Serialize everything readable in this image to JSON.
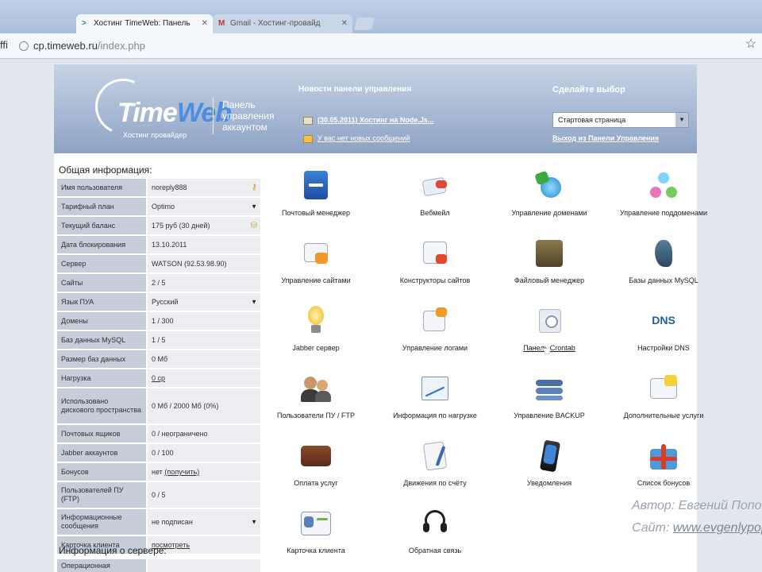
{
  "browser": {
    "tabs": [
      {
        "title": "Хостинг TimeWeb: Панель",
        "active": true,
        "icon": "chevron-logo-icon"
      },
      {
        "title": "Gmail - Хостинг-провайд",
        "active": false,
        "icon": "gmail-icon"
      }
    ],
    "url_host": "cp.timeweb.ru",
    "url_path": "/index.php",
    "menu_glyph": "ffi"
  },
  "header": {
    "logo_time": "Time",
    "logo_web": "Web",
    "logo_sub": "Хостинг провайдер",
    "panel_text": "Панель управления аккаунтом",
    "news_title": "Новости панели управления",
    "news_items": [
      {
        "text": "(30.05.2011) Хостинг на Node.Js..."
      },
      {
        "text": "У вас нет новых сообщений"
      }
    ],
    "choose_title": "Сделайте выбор",
    "select_value": "Стартовая страница",
    "logout": "Выход из Панели Управления"
  },
  "info": {
    "title": "Общая информация:",
    "rows": [
      {
        "label": "Имя пользователя",
        "value": "noreply888",
        "icon": "key-icon"
      },
      {
        "label": "Тарифный план",
        "value": "Optimo",
        "icon": "dropdown-icon"
      },
      {
        "label": "Текущий баланс",
        "value": "175 руб (30 дней)",
        "icon": "coins-icon"
      },
      {
        "label": "Дата блокирования",
        "value": "13.10.2011"
      },
      {
        "label": "Сервер",
        "value": "WATSON (92.53.98.90)"
      },
      {
        "label": "Сайты",
        "value": "2 / 5"
      },
      {
        "label": "Язык ПУА",
        "value": "Русский",
        "icon": "dropdown-icon"
      },
      {
        "label": "Домены",
        "value": "1 / 300"
      },
      {
        "label": "Баз данных MySQL",
        "value": "1 / 5"
      },
      {
        "label": "Размер баз данных",
        "value": "0 Мб"
      },
      {
        "label": "Нагрузка",
        "value": "0 ср",
        "link": true
      },
      {
        "label": "Использовано дискового пространства",
        "value": "0 Мб / 2000 Мб (0%)"
      },
      {
        "label": "Почтовых ящиков",
        "value": "0 / неограничено"
      },
      {
        "label": "Jabber аккаунтов",
        "value": "0 / 100"
      },
      {
        "label": "Бонусов",
        "value": "нет",
        "value_link": "(получить)"
      },
      {
        "label": "Пользователей ПУ (FTP)",
        "value": "0 / 5"
      },
      {
        "label": "Информационные сообщения",
        "value": "не подписан",
        "icon": "dropdown-icon"
      },
      {
        "label": "Карточка клиента",
        "value": "посмотреть",
        "link": true
      }
    ],
    "server_title": "Информация о сервере:",
    "server_first_label": "Операционная"
  },
  "grid": [
    {
      "label": "Почтовый менеджер",
      "icon": "mail-manager-icon"
    },
    {
      "label": "Вебмейл",
      "icon": "webmail-icon"
    },
    {
      "label": "Управление доменами",
      "icon": "domains-icon"
    },
    {
      "label": "Управление поддоменами",
      "icon": "subdomains-icon"
    },
    {
      "label": "Управление сайтами",
      "icon": "sites-icon"
    },
    {
      "label": "Конструкторы сайтов",
      "icon": "site-builder-icon"
    },
    {
      "label": "Файловый менеджер",
      "icon": "file-manager-icon"
    },
    {
      "label": "Базы данных MySQL",
      "icon": "mysql-icon"
    },
    {
      "label": "Jabber сервер",
      "icon": "jabber-bulb-icon"
    },
    {
      "label": "Управление логами",
      "icon": "logs-icon"
    },
    {
      "label": "Панель Crontab",
      "icon": "crontab-icon"
    },
    {
      "label": "Настройки DNS",
      "icon": "dns-icon",
      "icon_text": "DNS"
    },
    {
      "label": "Пользователи ПУ / FTP",
      "icon": "users-icon"
    },
    {
      "label": "Информация по нагрузке",
      "icon": "load-chart-icon"
    },
    {
      "label": "Управление BACKUP",
      "icon": "backup-icon"
    },
    {
      "label": "Дополнительные услуги",
      "icon": "extra-services-icon"
    },
    {
      "label": "Оплата услуг",
      "icon": "wallet-icon"
    },
    {
      "label": "Движения по счёту",
      "icon": "account-moves-icon"
    },
    {
      "label": "Уведомления",
      "icon": "phone-icon"
    },
    {
      "label": "Список бонусов",
      "icon": "gift-icon"
    },
    {
      "label": "Карточка клиента",
      "icon": "client-card-icon"
    },
    {
      "label": "Обратная связь",
      "icon": "headset-icon"
    }
  ],
  "watermark": {
    "author": "Автор: Евгений Попо",
    "site_prefix": "Сайт: ",
    "site": "www.evgenlypopov"
  },
  "colors": {
    "header_top": "#c7d3e5",
    "header_bottom": "#8da3c5",
    "label_bg": "#c5cdd8",
    "value_bg": "#eceef1",
    "accent": "#4d8ee0"
  }
}
